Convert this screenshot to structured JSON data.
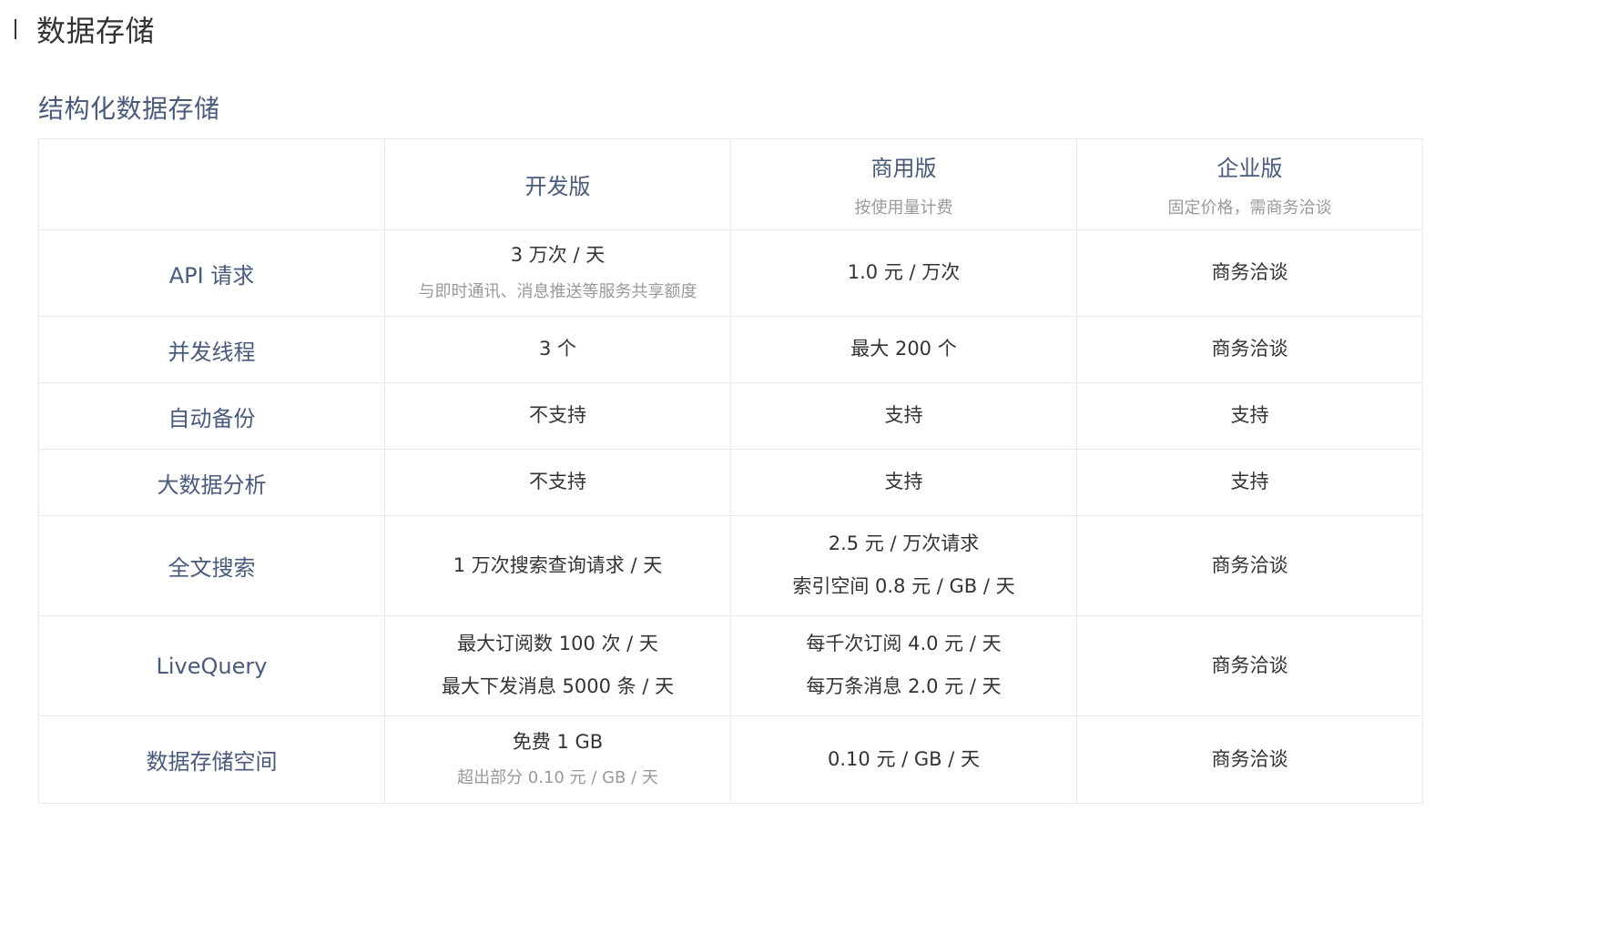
{
  "section": {
    "title": "数据存储"
  },
  "subsection": {
    "title": "结构化数据存储"
  },
  "table": {
    "headers": [
      {
        "name": "",
        "sub": ""
      },
      {
        "name": "开发版",
        "sub": ""
      },
      {
        "name": "商用版",
        "sub": "按使用量计费"
      },
      {
        "name": "企业版",
        "sub": "固定价格，需商务洽谈"
      }
    ],
    "rows": [
      {
        "label": "API 请求",
        "dev": {
          "main": "3 万次 / 天",
          "note": "与即时通讯、消息推送等服务共享额度"
        },
        "commercial": {
          "main": "1.0 元 / 万次"
        },
        "enterprise": {
          "main": "商务洽谈"
        }
      },
      {
        "label": "并发线程",
        "dev": {
          "main": "3 个"
        },
        "commercial": {
          "main": "最大 200 个"
        },
        "enterprise": {
          "main": "商务洽谈"
        }
      },
      {
        "label": "自动备份",
        "dev": {
          "main": "不支持"
        },
        "commercial": {
          "main": "支持"
        },
        "enterprise": {
          "main": "支持"
        }
      },
      {
        "label": "大数据分析",
        "dev": {
          "main": "不支持"
        },
        "commercial": {
          "main": "支持"
        },
        "enterprise": {
          "main": "支持"
        }
      },
      {
        "label": "全文搜索",
        "dev": {
          "main": "1 万次搜索查询请求 / 天"
        },
        "commercial": {
          "main": "2.5 元 / 万次请求",
          "line2": "索引空间 0.8 元 / GB / 天"
        },
        "enterprise": {
          "main": "商务洽谈"
        }
      },
      {
        "label": "LiveQuery",
        "dev": {
          "main": "最大订阅数 100 次 / 天",
          "line2": "最大下发消息 5000 条 / 天"
        },
        "commercial": {
          "main": "每千次订阅 4.0 元 / 天",
          "line2": "每万条消息 2.0 元 / 天"
        },
        "enterprise": {
          "main": "商务洽谈"
        }
      },
      {
        "label": "数据存储空间",
        "dev": {
          "main": "免费 1 GB",
          "note": "超出部分 0.10 元 / GB / 天"
        },
        "commercial": {
          "main": "0.10 元 / GB / 天"
        },
        "enterprise": {
          "main": "商务洽谈"
        }
      }
    ]
  }
}
